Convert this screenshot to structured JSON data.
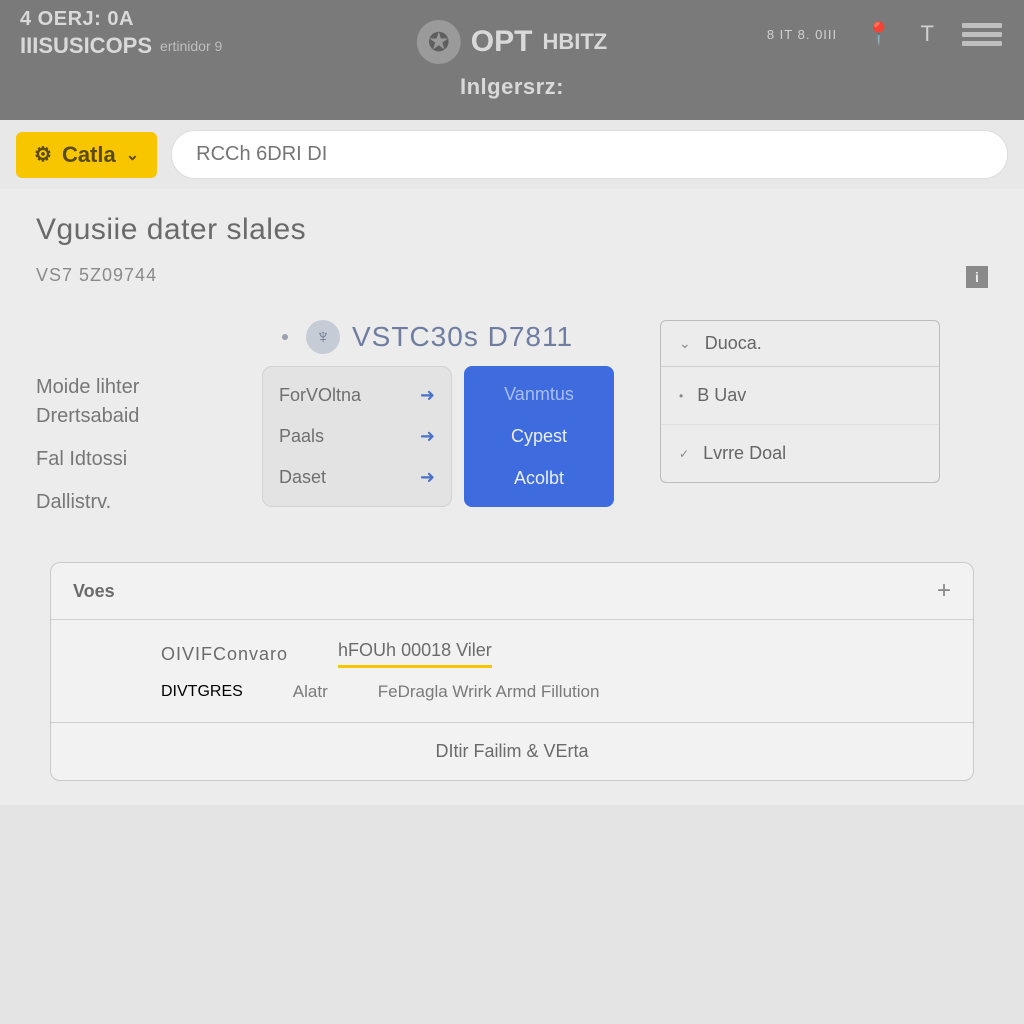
{
  "header": {
    "top_left_small": "4 OERJ:   0A",
    "brand": "IIISUSICOPS",
    "brand_sub": "ertinidor 9",
    "logo_main": "OPT",
    "logo_side": "HBITZ",
    "subtitle": "Inlgersrz:",
    "meta": "8 IT  8.  0III",
    "pin_icon": "📍",
    "t_icon": "T"
  },
  "nav": {
    "cata_label": "Catla",
    "search_placeholder": "RCCh 6DRI DI"
  },
  "page": {
    "title": "Vgusiie dater slales",
    "subcode": "VS7 5Z09744"
  },
  "left_labels": {
    "l1a": "Moide lihter",
    "l1b": "Drertsabaid",
    "l2": "Fal Idtossi",
    "l3": "Dallistrv."
  },
  "center": {
    "title": "VSTC30s D7811",
    "grey_items": [
      "ForVOltna",
      "Paals",
      "Daset"
    ],
    "blue_items": {
      "top": "Vanmtus",
      "mid": "Cypest",
      "bot": "Acolbt"
    }
  },
  "right_panel": {
    "header": "Duoca.",
    "item1": "B Uav",
    "item2": "Lvrre Doal"
  },
  "card": {
    "header": "Voes",
    "row1_k": "OIVIFConvaro",
    "row1_v": "hFOUh 00018 Viler",
    "row2_k": "DIVTGRES",
    "row2_sub1": "Alatr",
    "row2_sub2": "FeDragla Wrirk Armd Fillution",
    "footer": "DItir Failim & VErta"
  }
}
